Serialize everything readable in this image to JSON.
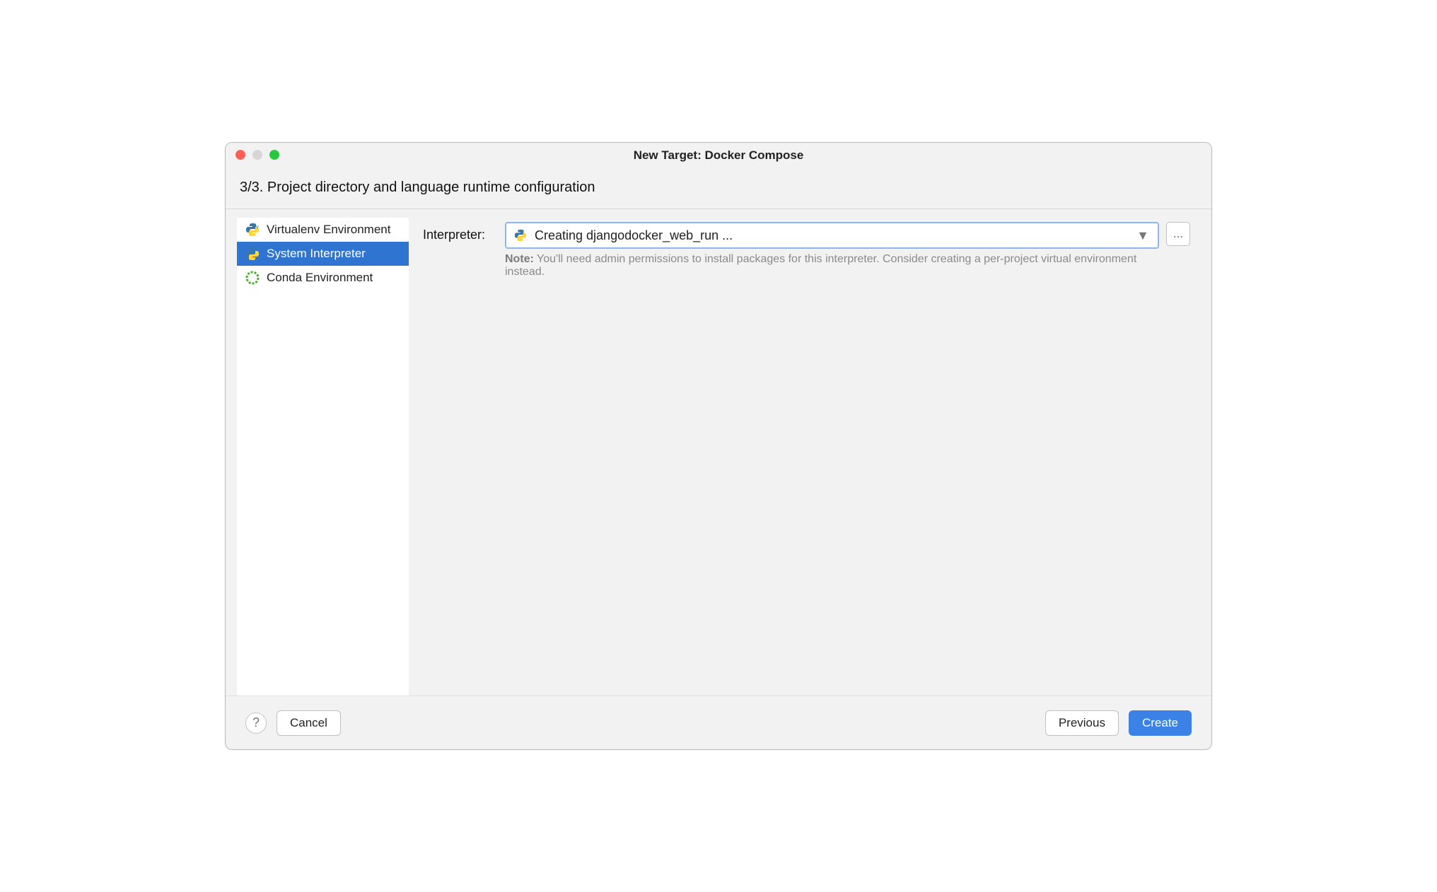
{
  "window": {
    "title": "New Target: Docker Compose"
  },
  "subheader": "3/3. Project directory and language runtime configuration",
  "sidebar": {
    "items": [
      {
        "label": "Virtualenv Environment",
        "icon": "python-venv"
      },
      {
        "label": "System Interpreter",
        "icon": "python-sys"
      },
      {
        "label": "Conda Environment",
        "icon": "conda"
      }
    ],
    "selected_index": 1
  },
  "main": {
    "interpreter_label": "Interpreter:",
    "interpreter_value": "Creating djangodocker_web_run ...",
    "browse_label": "...",
    "note_prefix": "Note:",
    "note_text": " You'll need admin permissions to install packages for this interpreter. Consider creating a per-project virtual environment instead."
  },
  "footer": {
    "help_tooltip": "?",
    "cancel": "Cancel",
    "previous": "Previous",
    "create": "Create"
  }
}
